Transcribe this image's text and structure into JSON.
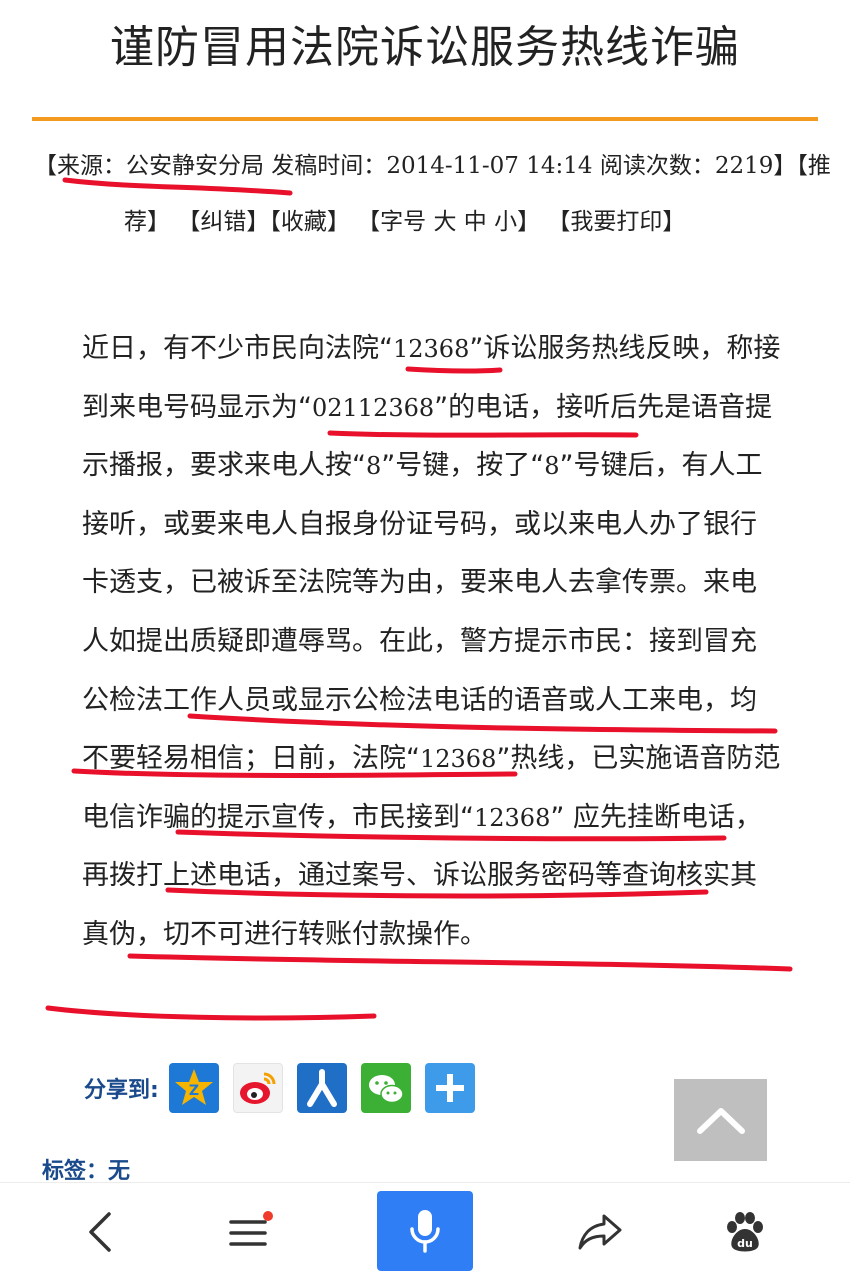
{
  "article": {
    "title": "谨防冒用法院诉讼服务热线诈骗",
    "meta": {
      "source_label": "【来源：公安静安分局 发稿时间：",
      "date": "2014-11-07 14:14",
      "reads_label": " 阅读次数：",
      "reads": "2219",
      "recommend_part1": "】【推",
      "recommend_part2": "荐】",
      "correct": "【纠错】",
      "favorite": "【收藏】",
      "font_label": "【字号",
      "font_large": "大",
      "font_medium": "中",
      "font_small": "小】",
      "print": "【我要打印】"
    },
    "body": [
      {
        "t": "近日，有不少市民向法院“",
        "n": false
      },
      {
        "t": "12368",
        "n": true
      },
      {
        "t": "”诉讼服务热线反映，称接到来电号码显示为“",
        "n": false
      },
      {
        "t": "02112368",
        "n": true
      },
      {
        "t": "”的电话，接听后先是语音提示播报，要求来电人按“",
        "n": false
      },
      {
        "t": "8",
        "n": true
      },
      {
        "t": "”号键，按了“",
        "n": false
      },
      {
        "t": "8",
        "n": true
      },
      {
        "t": "”号键后，有人工接听，或要来电人自报身份证号码，或以来电人办了银行卡透支，已被诉至法院等为由，要来电人去拿传票。来电人如提出质疑即遭辱骂。在此，警方提示市民：接到冒充公检法工作人员或显示公检法电话的语音或人工来电，均不要轻易相信；日前，法院“",
        "n": false
      },
      {
        "t": "12368",
        "n": true
      },
      {
        "t": "”热线，已实施语音防范电信诈骗的提示宣传，市民接到“",
        "n": false
      },
      {
        "t": "12368",
        "n": true
      },
      {
        "t": "” 应先挂断电话，再拨打上述电话，通过案号、诉讼服务密码等查询核实其真伪，切不可进行转账付款操作。",
        "n": false
      }
    ]
  },
  "share": {
    "label": "分享到:",
    "buttons": [
      {
        "name": "qzone",
        "color": "#f5b400"
      },
      {
        "name": "weibo",
        "color": "#e6162d"
      },
      {
        "name": "renren",
        "color": "#1f6fc6"
      },
      {
        "name": "wechat",
        "color": "#3cb034"
      },
      {
        "name": "more",
        "color": "#3d9be9"
      }
    ]
  },
  "tags": {
    "label": "标签：无"
  },
  "bottom_nav": {
    "back": "back-icon",
    "menu": "menu-icon",
    "voice": "microphone-icon",
    "share": "share-icon",
    "home": "baidu-paw-icon"
  },
  "colors": {
    "accent_orange": "#f39a1f",
    "link_blue": "#1a4a8c",
    "voice_blue": "#2f7ef5",
    "annotation_red": "#e8102a"
  }
}
